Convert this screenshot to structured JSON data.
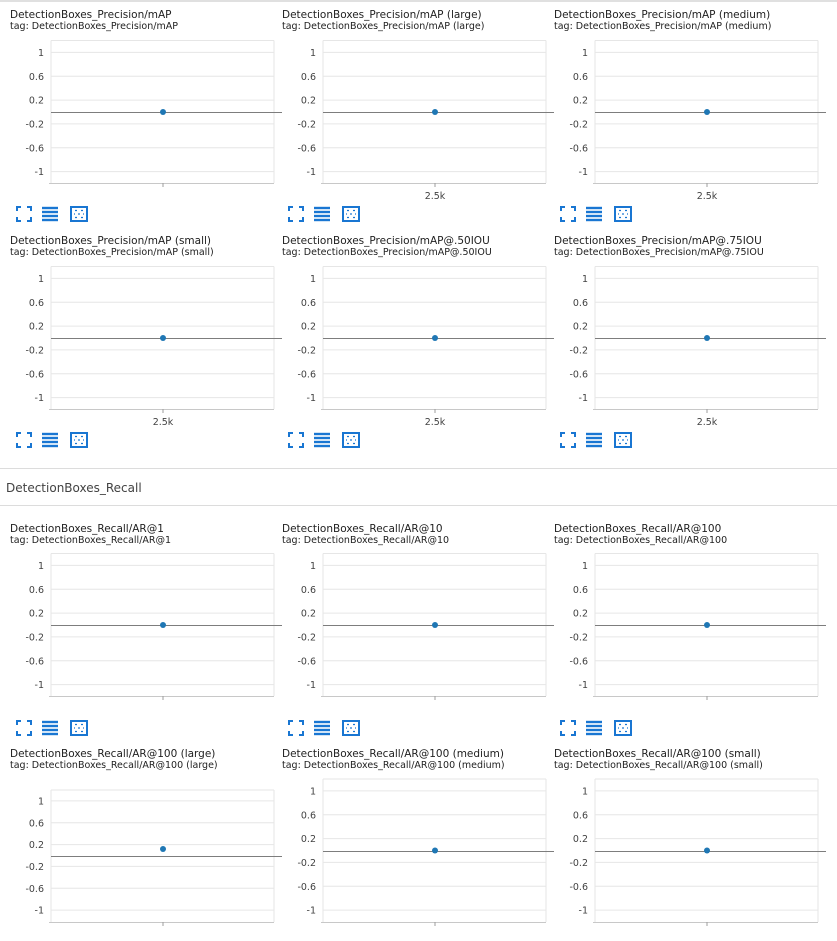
{
  "colors": {
    "point": "#1f77b4",
    "grid": "#e6e6e6",
    "zeroline": "#7d7d7d",
    "icon": "#1976d2"
  },
  "toolbar_icons": [
    "fit-to-screen-icon",
    "toggle-y-axis-log-icon",
    "fit-domain-icon"
  ],
  "sections": [
    {
      "title": ""
    },
    {
      "title": "DetectionBoxes_Recall"
    }
  ],
  "cards": [
    {
      "title": "DetectionBoxes_Precision/mAP",
      "tag": "tag: DetectionBoxes_Precision/mAP"
    },
    {
      "title": "DetectionBoxes_Precision/mAP (large)",
      "tag": "tag: DetectionBoxes_Precision/mAP (large)"
    },
    {
      "title": "DetectionBoxes_Precision/mAP (medium)",
      "tag": "tag: DetectionBoxes_Precision/mAP (medium)"
    },
    {
      "title": "DetectionBoxes_Precision/mAP (small)",
      "tag": "tag: DetectionBoxes_Precision/mAP (small)"
    },
    {
      "title": "DetectionBoxes_Precision/mAP@.50IOU",
      "tag": "tag: DetectionBoxes_Precision/mAP@.50IOU"
    },
    {
      "title": "DetectionBoxes_Precision/mAP@.75IOU",
      "tag": "tag: DetectionBoxes_Precision/mAP@.75IOU"
    },
    {
      "title": "DetectionBoxes_Recall/AR@1",
      "tag": "tag: DetectionBoxes_Recall/AR@1"
    },
    {
      "title": "DetectionBoxes_Recall/AR@10",
      "tag": "tag: DetectionBoxes_Recall/AR@10"
    },
    {
      "title": "DetectionBoxes_Recall/AR@100",
      "tag": "tag: DetectionBoxes_Recall/AR@100"
    },
    {
      "title": "DetectionBoxes_Recall/AR@100 (large)",
      "tag": "tag: DetectionBoxes_Recall/AR@100 (large)"
    },
    {
      "title": "DetectionBoxes_Recall/AR@100 (medium)",
      "tag": "tag: DetectionBoxes_Recall/AR@100 (medium)"
    },
    {
      "title": "DetectionBoxes_Recall/AR@100 (small)",
      "tag": "tag: DetectionBoxes_Recall/AR@100 (small)"
    }
  ],
  "chart_data": [
    {
      "type": "scatter",
      "title": "DetectionBoxes_Precision/mAP",
      "y_ticks": [
        "1",
        "0.6",
        "0.2",
        "-0.2",
        "-0.6",
        "-1"
      ],
      "x_ticks": [],
      "ylim": [
        -1.2,
        1.2
      ],
      "x_tick_value": 2500,
      "series": [
        {
          "x": [
            2500
          ],
          "y": [
            0
          ]
        }
      ],
      "grid": true
    },
    {
      "type": "scatter",
      "title": "DetectionBoxes_Precision/mAP (large)",
      "y_ticks": [
        "1",
        "0.6",
        "0.2",
        "-0.2",
        "-0.6",
        "-1"
      ],
      "x_ticks": [
        "2.5k"
      ],
      "ylim": [
        -1.2,
        1.2
      ],
      "x_tick_value": 2500,
      "series": [
        {
          "x": [
            2500
          ],
          "y": [
            0
          ]
        }
      ],
      "grid": true
    },
    {
      "type": "scatter",
      "title": "DetectionBoxes_Precision/mAP (medium)",
      "y_ticks": [
        "1",
        "0.6",
        "0.2",
        "-0.2",
        "-0.6",
        "-1"
      ],
      "x_ticks": [
        "2.5k"
      ],
      "ylim": [
        -1.2,
        1.2
      ],
      "x_tick_value": 2500,
      "series": [
        {
          "x": [
            2500
          ],
          "y": [
            0
          ]
        }
      ],
      "grid": true
    },
    {
      "type": "scatter",
      "title": "DetectionBoxes_Precision/mAP (small)",
      "y_ticks": [
        "1",
        "0.6",
        "0.2",
        "-0.2",
        "-0.6",
        "-1"
      ],
      "x_ticks": [
        "2.5k"
      ],
      "ylim": [
        -1.2,
        1.2
      ],
      "x_tick_value": 2500,
      "series": [
        {
          "x": [
            2500
          ],
          "y": [
            0
          ]
        }
      ],
      "grid": true
    },
    {
      "type": "scatter",
      "title": "DetectionBoxes_Precision/mAP@.50IOU",
      "y_ticks": [
        "1",
        "0.6",
        "0.2",
        "-0.2",
        "-0.6",
        "-1"
      ],
      "x_ticks": [
        "2.5k"
      ],
      "ylim": [
        -1.2,
        1.2
      ],
      "x_tick_value": 2500,
      "series": [
        {
          "x": [
            2500
          ],
          "y": [
            0
          ]
        }
      ],
      "grid": true
    },
    {
      "type": "scatter",
      "title": "DetectionBoxes_Precision/mAP@.75IOU",
      "y_ticks": [
        "1",
        "0.6",
        "0.2",
        "-0.2",
        "-0.6",
        "-1"
      ],
      "x_ticks": [
        "2.5k"
      ],
      "ylim": [
        -1.2,
        1.2
      ],
      "x_tick_value": 2500,
      "series": [
        {
          "x": [
            2500
          ],
          "y": [
            0
          ]
        }
      ],
      "grid": true
    },
    {
      "type": "scatter",
      "title": "DetectionBoxes_Recall/AR@1",
      "y_ticks": [
        "1",
        "0.6",
        "0.2",
        "-0.2",
        "-0.6",
        "-1"
      ],
      "x_ticks": [],
      "ylim": [
        -1.2,
        1.2
      ],
      "x_tick_value": 2500,
      "series": [
        {
          "x": [
            2500
          ],
          "y": [
            0
          ]
        }
      ],
      "grid": true
    },
    {
      "type": "scatter",
      "title": "DetectionBoxes_Recall/AR@10",
      "y_ticks": [
        "1",
        "0.6",
        "0.2",
        "-0.2",
        "-0.6",
        "-1"
      ],
      "x_ticks": [],
      "ylim": [
        -1.2,
        1.2
      ],
      "x_tick_value": 2500,
      "series": [
        {
          "x": [
            2500
          ],
          "y": [
            0
          ]
        }
      ],
      "grid": true
    },
    {
      "type": "scatter",
      "title": "DetectionBoxes_Recall/AR@100",
      "y_ticks": [
        "1",
        "0.6",
        "0.2",
        "-0.2",
        "-0.6",
        "-1"
      ],
      "x_ticks": [],
      "ylim": [
        -1.2,
        1.2
      ],
      "x_tick_value": 2500,
      "series": [
        {
          "x": [
            2500
          ],
          "y": [
            0
          ]
        }
      ],
      "grid": true
    },
    {
      "type": "scatter",
      "title": "DetectionBoxes_Recall/AR@100 (large)",
      "y_ticks": [
        "1",
        "0.6",
        "0.2",
        "-0.2",
        "-0.6",
        "-1"
      ],
      "x_ticks": [],
      "ylim": [
        -1.2,
        1.2
      ],
      "x_tick_value": 2500,
      "series": [
        {
          "x": [
            2500
          ],
          "y": [
            0.12
          ]
        }
      ],
      "grid": true
    },
    {
      "type": "scatter",
      "title": "DetectionBoxes_Recall/AR@100 (medium)",
      "y_ticks": [
        "1",
        "0.6",
        "0.2",
        "-0.2",
        "-0.6",
        "-1"
      ],
      "x_ticks": [],
      "ylim": [
        -1.2,
        1.2
      ],
      "x_tick_value": 2500,
      "series": [
        {
          "x": [
            2500
          ],
          "y": [
            0
          ]
        }
      ],
      "grid": true
    },
    {
      "type": "scatter",
      "title": "DetectionBoxes_Recall/AR@100 (small)",
      "y_ticks": [
        "1",
        "0.6",
        "0.2",
        "-0.2",
        "-0.6",
        "-1"
      ],
      "x_ticks": [],
      "ylim": [
        -1.2,
        1.2
      ],
      "x_tick_value": 2500,
      "series": [
        {
          "x": [
            2500
          ],
          "y": [
            0
          ]
        }
      ],
      "grid": true
    }
  ]
}
